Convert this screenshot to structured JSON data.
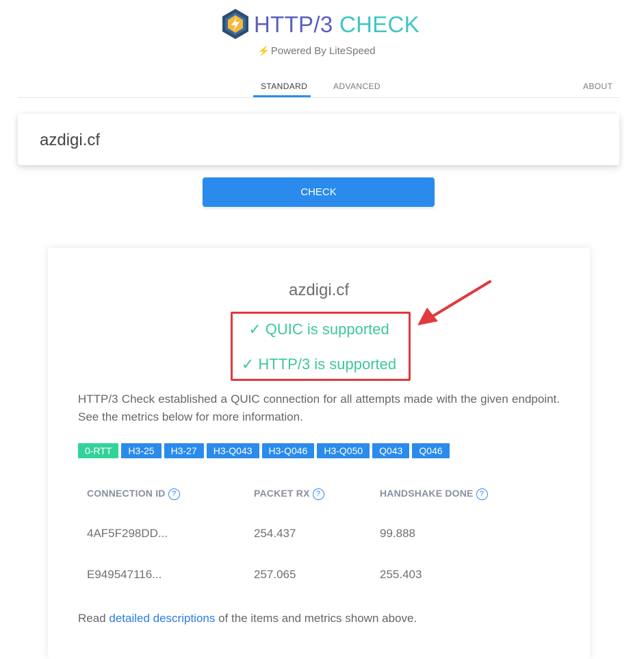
{
  "brand": {
    "title_part1": "HTTP/3",
    "title_part2": "CHECK",
    "powered_by": "Powered By LiteSpeed",
    "logo_icon": "litespeed-logo-icon",
    "colors": {
      "title_part1": "#5b5fbd",
      "title_part2": "#3ec6c4",
      "bolt": "#ef8b2c"
    }
  },
  "tabs": [
    {
      "label": "STANDARD",
      "active": true
    },
    {
      "label": "ADVANCED",
      "active": false
    },
    {
      "label": "ABOUT",
      "active": false
    }
  ],
  "search": {
    "value": "azdigi.cf",
    "button_label": "CHECK"
  },
  "result": {
    "domain": "azdigi.cf",
    "quic_status": "✓ QUIC is supported",
    "http3_status": "✓ HTTP/3 is supported",
    "description": "HTTP/3 Check established a QUIC connection for all attempts made with the given endpoint. See the metrics below for more information.",
    "versions": [
      {
        "label": "0-RTT",
        "color": "#34d29a"
      },
      {
        "label": "H3-25",
        "color": "#2a8bec"
      },
      {
        "label": "H3-27",
        "color": "#2a8bec"
      },
      {
        "label": "H3-Q043",
        "color": "#2a8bec"
      },
      {
        "label": "H3-Q046",
        "color": "#2a8bec"
      },
      {
        "label": "H3-Q050",
        "color": "#2a8bec"
      },
      {
        "label": "Q043",
        "color": "#2a8bec"
      },
      {
        "label": "Q046",
        "color": "#2a8bec"
      }
    ],
    "table": {
      "headers": [
        "CONNECTION ID",
        "PACKET RX",
        "HANDSHAKE DONE"
      ],
      "help_icon": "?",
      "rows": [
        [
          "4AF5F298DD...",
          "254.437",
          "99.888"
        ],
        [
          "E949547116...",
          "257.065",
          "255.403"
        ]
      ]
    },
    "footer": {
      "prefix": "Read ",
      "link": "detailed descriptions",
      "suffix": " of the items and metrics shown above."
    }
  },
  "accent_colors": {
    "primary": "#2a8bec",
    "success": "#3dc89a",
    "highlight": "#e0393e"
  }
}
